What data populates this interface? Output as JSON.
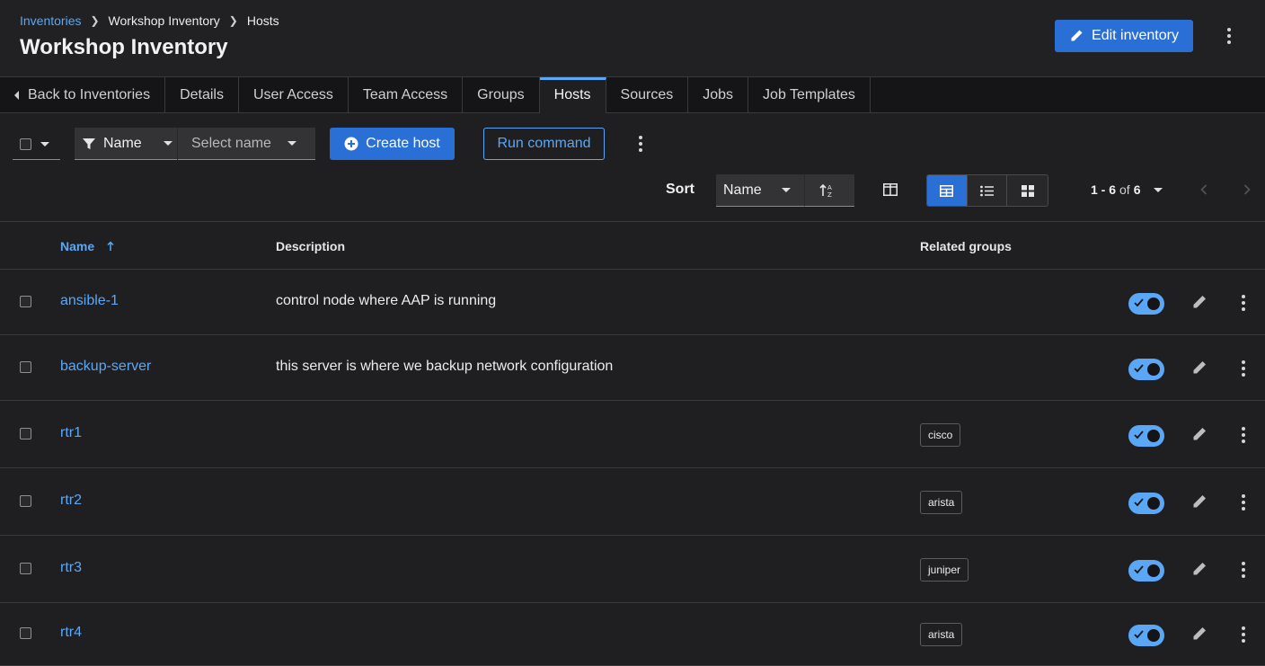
{
  "breadcrumb": {
    "root": "Inventories",
    "inventory": "Workshop Inventory",
    "current": "Hosts"
  },
  "header": {
    "title": "Workshop Inventory",
    "edit_label": "Edit inventory"
  },
  "tabs": [
    {
      "label": "Back to Inventories"
    },
    {
      "label": "Details"
    },
    {
      "label": "User Access"
    },
    {
      "label": "Team Access"
    },
    {
      "label": "Groups"
    },
    {
      "label": "Hosts"
    },
    {
      "label": "Sources"
    },
    {
      "label": "Jobs"
    },
    {
      "label": "Job Templates"
    }
  ],
  "toolbar": {
    "filter_attribute": "Name",
    "filter_placeholder": "Select name",
    "create_label": "Create host",
    "run_label": "Run command",
    "sort_label": "Sort",
    "sort_field": "Name",
    "pagination": {
      "range": "1 - 6",
      "of": "of",
      "total": "6"
    }
  },
  "table": {
    "columns": {
      "name": "Name",
      "description": "Description",
      "groups": "Related groups"
    },
    "rows": [
      {
        "name": "ansible-1",
        "description": "control node where AAP is running",
        "group": "",
        "enabled": true
      },
      {
        "name": "backup-server",
        "description": "this server is where we backup network configuration",
        "group": "",
        "enabled": true
      },
      {
        "name": "rtr1",
        "description": "",
        "group": "cisco",
        "enabled": true
      },
      {
        "name": "rtr2",
        "description": "",
        "group": "arista",
        "enabled": true
      },
      {
        "name": "rtr3",
        "description": "",
        "group": "juniper",
        "enabled": true
      },
      {
        "name": "rtr4",
        "description": "",
        "group": "arista",
        "enabled": true
      }
    ]
  },
  "colors": {
    "accent": "#5aa8f5",
    "primary": "#2a6fd6",
    "background": "#1f1f22"
  }
}
